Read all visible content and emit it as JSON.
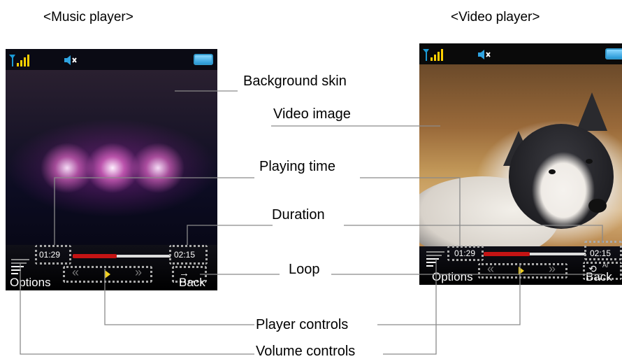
{
  "headings": {
    "music": "<Music player>",
    "video": "<Video player>"
  },
  "labels": {
    "background_skin": "Background skin",
    "video_image": "Video image",
    "playing_time": "Playing time",
    "duration": "Duration",
    "loop": "Loop",
    "player_controls": "Player controls",
    "volume_controls": "Volume controls"
  },
  "music_player": {
    "playing_time": "01:29",
    "duration": "02:15",
    "progress": 0.45,
    "options_label": "Options",
    "back_label": "Back",
    "loop_glyph": "→"
  },
  "video_player": {
    "playing_time": "01:29",
    "duration": "02:15",
    "progress": 0.45,
    "options_label": "Options",
    "back_label": "Back",
    "loop_glyph": "Al"
  },
  "colors": {
    "progress": "#c41414",
    "battery": "#2a9ad8",
    "play": "#f0d020"
  }
}
